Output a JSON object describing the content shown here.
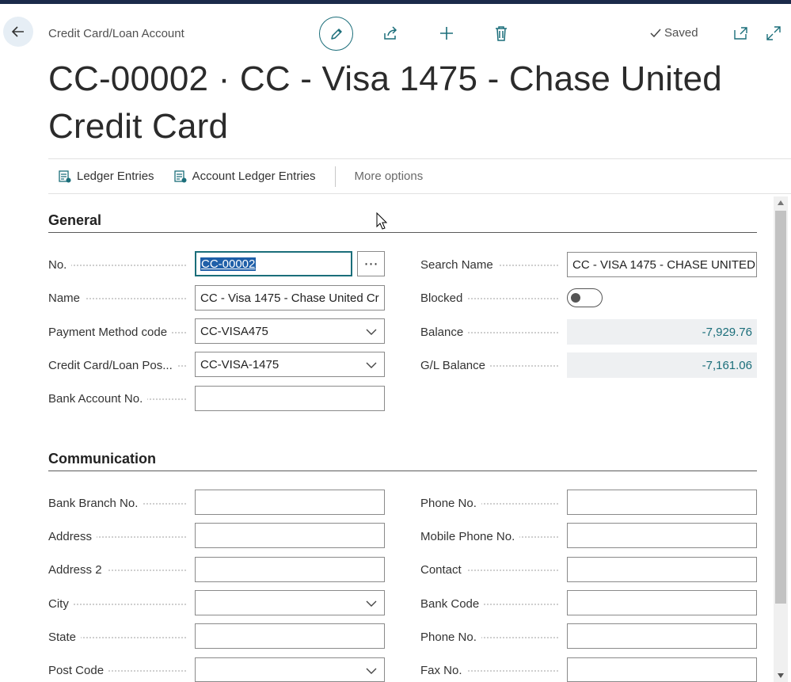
{
  "header": {
    "breadcrumb": "Credit Card/Loan Account",
    "status": "Saved",
    "title": "CC-00002 · CC - Visa 1475 - Chase United Credit Card"
  },
  "action_bar": {
    "items": [
      {
        "label": "Ledger Entries",
        "icon": "ledger-icon"
      },
      {
        "label": "Account Ledger Entries",
        "icon": "ledger-icon"
      }
    ],
    "more": "More options"
  },
  "general": {
    "heading": "General",
    "no": {
      "label": "No.",
      "value": "CC-00002"
    },
    "name": {
      "label": "Name",
      "value": "CC - Visa 1475 - Chase United Cr"
    },
    "payment_method": {
      "label": "Payment Method code",
      "value": "CC-VISA475"
    },
    "posting_group": {
      "label": "Credit Card/Loan Pos...",
      "value": "CC-VISA-1475"
    },
    "bank_account_no": {
      "label": "Bank Account No.",
      "value": ""
    },
    "search_name": {
      "label": "Search Name",
      "value": "CC - VISA 1475 - CHASE UNITED"
    },
    "blocked": {
      "label": "Blocked",
      "value": false
    },
    "balance": {
      "label": "Balance",
      "value": "-7,929.76"
    },
    "gl_balance": {
      "label": "G/L Balance",
      "value": "-7,161.06"
    }
  },
  "communication": {
    "heading": "Communication",
    "left": [
      {
        "label": "Bank Branch No.",
        "value": "",
        "type": "text"
      },
      {
        "label": "Address",
        "value": "",
        "type": "text"
      },
      {
        "label": "Address 2",
        "value": "",
        "type": "text"
      },
      {
        "label": "City",
        "value": "",
        "type": "select"
      },
      {
        "label": "State",
        "value": "",
        "type": "text"
      },
      {
        "label": "Post Code",
        "value": "",
        "type": "select"
      }
    ],
    "right": [
      {
        "label": "Phone No.",
        "value": ""
      },
      {
        "label": "Mobile Phone No.",
        "value": ""
      },
      {
        "label": "Contact",
        "value": ""
      },
      {
        "label": "Bank Code",
        "value": ""
      },
      {
        "label": "Phone No.",
        "value": ""
      },
      {
        "label": "Fax No.",
        "value": ""
      }
    ]
  },
  "colors": {
    "accent": "#1b6e7a",
    "selection": "#1f5fa8",
    "readonly_bg": "#eef0f2"
  }
}
